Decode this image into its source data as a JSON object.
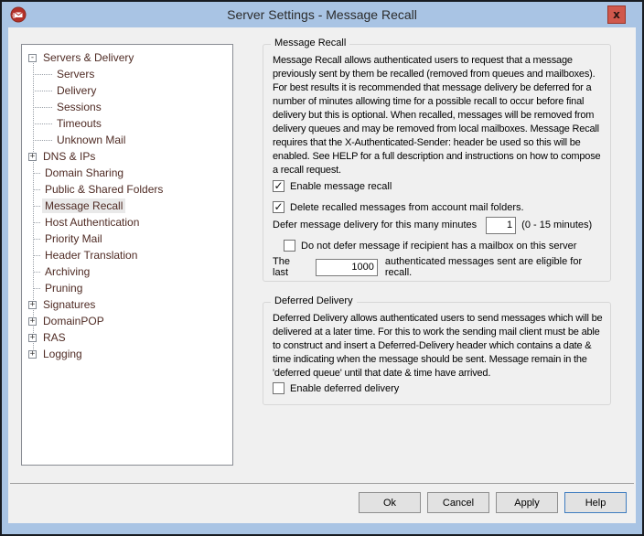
{
  "window": {
    "title": "Server Settings - Message Recall"
  },
  "icons": {
    "close": "x",
    "check": "✓"
  },
  "colors": {
    "titlebar_blue": "#a9c4e4",
    "close_red": "#d0584c",
    "close_border": "#9c3528",
    "dialog_bg": "#f0f0f0",
    "tree_text": "#4f2b24",
    "help_focus_border": "#3f7cbf"
  },
  "tree": {
    "items": [
      {
        "label": "Servers & Delivery",
        "box": "-",
        "level": 0,
        "selected": false
      },
      {
        "label": "Servers",
        "box": "",
        "level": 1,
        "selected": false
      },
      {
        "label": "Delivery",
        "box": "",
        "level": 1,
        "selected": false
      },
      {
        "label": "Sessions",
        "box": "",
        "level": 1,
        "selected": false
      },
      {
        "label": "Timeouts",
        "box": "",
        "level": 1,
        "selected": false
      },
      {
        "label": "Unknown Mail",
        "box": "",
        "level": 1,
        "selected": false
      },
      {
        "label": "DNS & IPs",
        "box": "+",
        "level": 0,
        "selected": false
      },
      {
        "label": "Domain Sharing",
        "box": "",
        "level": 0,
        "selected": false
      },
      {
        "label": "Public & Shared Folders",
        "box": "",
        "level": 0,
        "selected": false
      },
      {
        "label": "Message Recall",
        "box": "",
        "level": 0,
        "selected": true
      },
      {
        "label": "Host Authentication",
        "box": "",
        "level": 0,
        "selected": false
      },
      {
        "label": "Priority Mail",
        "box": "",
        "level": 0,
        "selected": false
      },
      {
        "label": "Header Translation",
        "box": "",
        "level": 0,
        "selected": false
      },
      {
        "label": "Archiving",
        "box": "",
        "level": 0,
        "selected": false
      },
      {
        "label": "Pruning",
        "box": "",
        "level": 0,
        "selected": false
      },
      {
        "label": "Signatures",
        "box": "+",
        "level": 0,
        "selected": false
      },
      {
        "label": "DomainPOP",
        "box": "+",
        "level": 0,
        "selected": false
      },
      {
        "label": "RAS",
        "box": "+",
        "level": 0,
        "selected": false
      },
      {
        "label": "Logging",
        "box": "+",
        "level": 0,
        "selected": false
      }
    ]
  },
  "recall_group": {
    "title": "Message Recall",
    "description": "Message Recall allows authenticated users to request that a message previously sent by them be recalled (removed from queues and mailboxes). For best results it is recommended that message delivery be deferred for a number of minutes allowing time for a possible recall to occur before final delivery but this is optional.  When recalled, messages will be removed from delivery queues and may be removed from local mailboxes. Message Recall requires that the X-Authenticated-Sender: header be used so this will be enabled. See HELP for a full description and instructions on how to compose a recall request.",
    "enable_checkbox": "Enable message recall",
    "enable_checked": true,
    "delete_checkbox": "Delete recalled messages from account mail folders.",
    "delete_checked": true,
    "defer_label": "Defer message delivery for this many minutes",
    "defer_value": "1",
    "defer_range": "(0 - 15 minutes)",
    "no_defer_checkbox": "Do not defer message if recipient has a mailbox on this server",
    "no_defer_checked": false,
    "last_label": "The last",
    "last_value": "1000",
    "last_suffix": "authenticated messages sent are eligible for recall."
  },
  "deferred_group": {
    "title": "Deferred Delivery",
    "description": "Deferred Delivery allows authenticated users to send messages which will be delivered at a later time.  For this to work the sending mail client must be able to construct and insert a Deferred-Delivery header which contains a date & time indicating when the message should be sent.  Message remain in the 'deferred queue' until that date & time have arrived.",
    "enable_checkbox": "Enable deferred delivery",
    "enable_checked": false
  },
  "buttons": {
    "ok": "Ok",
    "cancel": "Cancel",
    "apply": "Apply",
    "help": "Help"
  }
}
